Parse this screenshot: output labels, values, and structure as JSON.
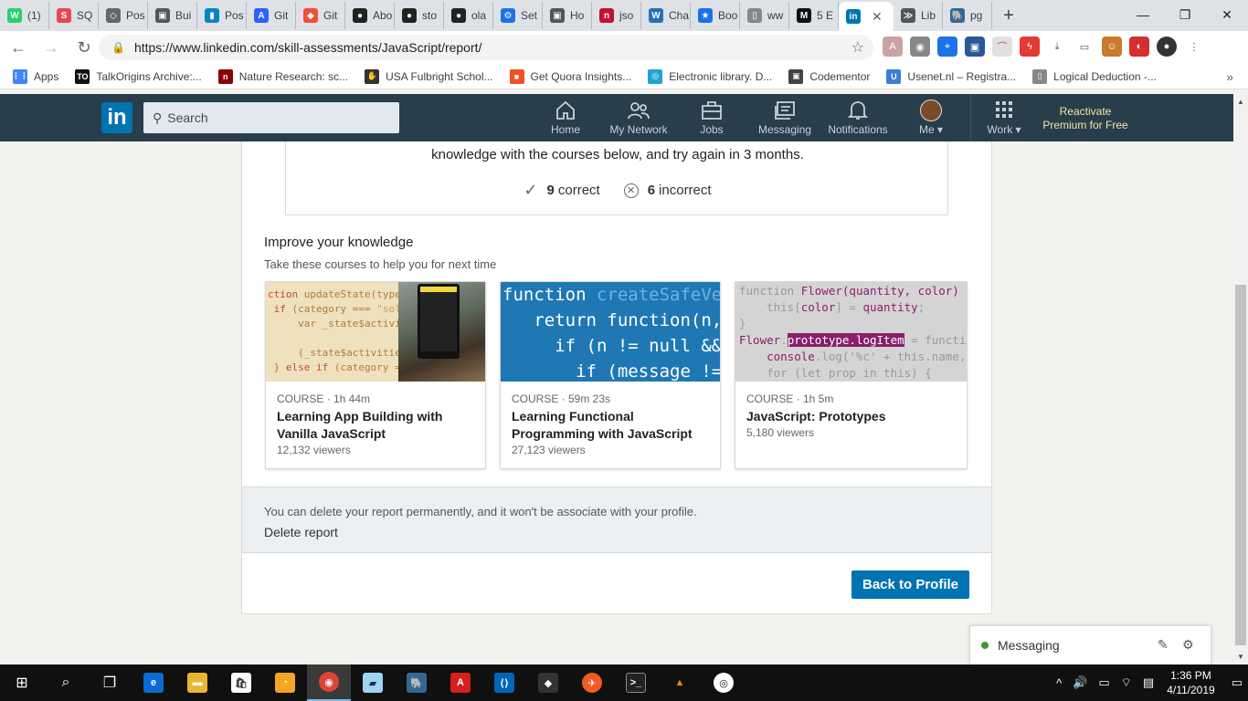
{
  "browser": {
    "tabs": [
      {
        "label": "(1)",
        "color": "#25d366",
        "glyph": "W"
      },
      {
        "label": "SQ",
        "color": "#e64a4a",
        "glyph": "S"
      },
      {
        "label": "Pos",
        "color": "#666666",
        "glyph": "◇"
      },
      {
        "label": "Bui",
        "color": "#555555",
        "glyph": "▣"
      },
      {
        "label": "Pos",
        "color": "#0a84c6",
        "glyph": "▮"
      },
      {
        "label": "Git",
        "color": "#2962ff",
        "glyph": "A"
      },
      {
        "label": "Git",
        "color": "#f05033",
        "glyph": "◆"
      },
      {
        "label": "Abo",
        "color": "#222222",
        "glyph": "●"
      },
      {
        "label": "sto",
        "color": "#222222",
        "glyph": "●"
      },
      {
        "label": "ola",
        "color": "#222222",
        "glyph": "●"
      },
      {
        "label": "Set",
        "color": "#1a73e8",
        "glyph": "⚙"
      },
      {
        "label": "Ho",
        "color": "#555555",
        "glyph": "▣"
      },
      {
        "label": "jso",
        "color": "#c41230",
        "glyph": "n"
      },
      {
        "label": "Cha",
        "color": "#2a6ebb",
        "glyph": "W"
      },
      {
        "label": "Boo",
        "color": "#1a73e8",
        "glyph": "★"
      },
      {
        "label": "ww",
        "color": "#888888",
        "glyph": "▯"
      },
      {
        "label": "5 E",
        "color": "#111111",
        "glyph": "M"
      },
      {
        "label": "",
        "color": "#0073b1",
        "glyph": "in",
        "active": true
      },
      {
        "label": "Lib",
        "color": "#555555",
        "glyph": "≫"
      },
      {
        "label": "pg",
        "color": "#336791",
        "glyph": "🐘"
      }
    ],
    "new_tab": "+",
    "window_controls": {
      "minimize": "—",
      "maximize": "❐",
      "close": "✕"
    },
    "url": "https://www.linkedin.com/skill-assessments/JavaScript/report/",
    "bookmarks": [
      {
        "label": "Apps",
        "color": "#4285f4",
        "glyph": "⋮⋮"
      },
      {
        "label": "TalkOrigins Archive:...",
        "color": "#111111",
        "glyph": "TO"
      },
      {
        "label": "Nature Research: sc...",
        "color": "#8b0000",
        "glyph": "n"
      },
      {
        "label": "USA Fulbright Schol...",
        "color": "#333333",
        "glyph": "✋"
      },
      {
        "label": "Get Quora Insights...",
        "color": "#f25022",
        "glyph": "■"
      },
      {
        "label": "Electronic library. D...",
        "color": "#1fa2d6",
        "glyph": "◎"
      },
      {
        "label": "Codementor",
        "color": "#444444",
        "glyph": "▣"
      },
      {
        "label": "Usenet.nl – Registra...",
        "color": "#3b7dd8",
        "glyph": "U"
      },
      {
        "label": "Logical Deduction -...",
        "color": "#888888",
        "glyph": "▯"
      }
    ],
    "bookmarks_more": "»"
  },
  "linkedin": {
    "logo": "in",
    "search_placeholder": "Search",
    "nav": {
      "home": "Home",
      "network": "My Network",
      "jobs": "Jobs",
      "messaging": "Messaging",
      "notifications": "Notifications",
      "me": "Me ▾",
      "work": "Work ▾"
    },
    "premium": "Reactivate Premium for Free"
  },
  "report": {
    "result_message": "knowledge with the courses below, and try again in 3 months.",
    "correct_count": "9",
    "correct_label": "correct",
    "incorrect_count": "6",
    "incorrect_label": "incorrect",
    "improve_title": "Improve your knowledge",
    "improve_subtitle": "Take these courses to help you for next time",
    "courses": [
      {
        "type": "COURSE · 1h 44m",
        "title": "Learning App Building with Vanilla JavaScript",
        "viewers": "12,132 viewers"
      },
      {
        "type": "COURSE · 59m 23s",
        "title": "Learning Functional Programming with JavaScript",
        "viewers": "27,123 viewers"
      },
      {
        "type": "COURSE · 1h 5m",
        "title": "JavaScript: Prototypes",
        "viewers": "5,180 viewers"
      }
    ],
    "delete_text": "You can delete your report permanently, and it won't be associate with your profile.",
    "delete_link": "Delete report",
    "back_button": "Back to Profile"
  },
  "messaging_widget": {
    "label": "Messaging"
  },
  "taskbar": {
    "time": "1:36 PM",
    "date": "4/11/2019"
  },
  "colors": {
    "linkedin_blue": "#0073b1",
    "nav_bg": "#283e4a",
    "premium_gold": "#f5e3a8"
  }
}
